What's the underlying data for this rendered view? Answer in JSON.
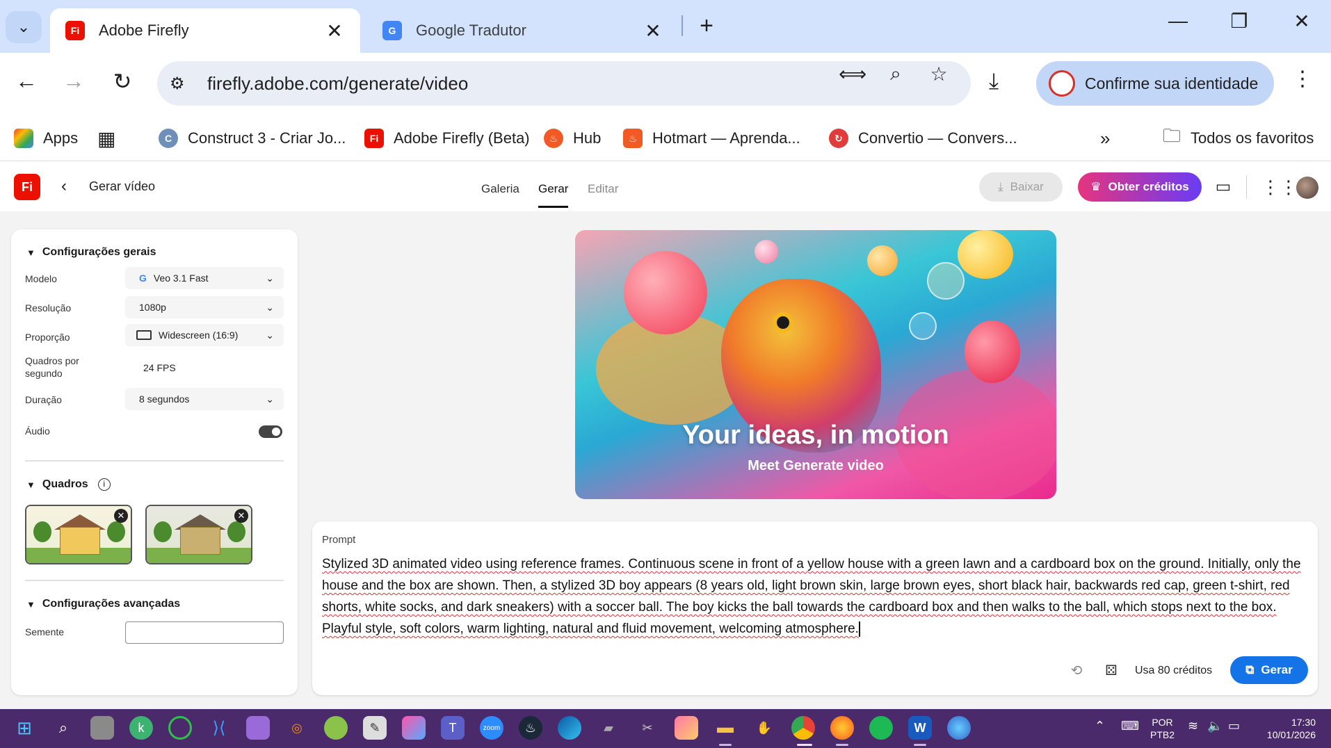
{
  "browser": {
    "tabs": [
      {
        "title": "Adobe Firefly",
        "active": true
      },
      {
        "title": "Google Tradutor",
        "active": false
      }
    ],
    "address": "firefly.adobe.com/generate/video",
    "profile_label": "Confirme sua identidade",
    "bookmarks": [
      "Apps",
      "Construct 3 - Criar Jo...",
      "Adobe Firefly (Beta)",
      "Hub",
      "Hotmart — Aprenda...",
      "Convertio — Convers...",
      "Todos os favoritos"
    ]
  },
  "app": {
    "page_title": "Gerar vídeo",
    "nav_tabs": [
      "Galeria",
      "Gerar",
      "Editar"
    ],
    "active_tab": "Gerar",
    "download_label": "Baixar",
    "credits_button": "Obter créditos",
    "colors": {
      "accent": "#1473e6",
      "logo": "#eb1000",
      "credits_gradient_start": "#e6347e",
      "credits_gradient_end": "#6a3cf5"
    }
  },
  "settings": {
    "general_title": "Configurações gerais",
    "model_label": "Modelo",
    "model_value": "Veo 3.1 Fast",
    "resolution_label": "Resolução",
    "resolution_value": "1080p",
    "aspect_label": "Proporção",
    "aspect_value": "Widescreen (16:9)",
    "fps_label_1": "Quadros por",
    "fps_label_2": "segundo",
    "fps_value": "24 FPS",
    "duration_label": "Duração",
    "duration_value": "8 segundos",
    "audio_label": "Áudio",
    "audio_on": true,
    "frames_title": "Quadros",
    "advanced_title": "Configurações avançadas",
    "seed_label": "Semente",
    "seed_value": ""
  },
  "hero": {
    "title": "Your ideas, in motion",
    "subtitle": "Meet Generate video"
  },
  "prompt": {
    "label": "Prompt",
    "text": "Stylized 3D animated video using reference frames. Continuous scene in front of a yellow house with a green lawn and a cardboard box on the ground. Initially, only the house and the box are shown. Then, a stylized 3D boy appears (8 years old, light brown skin, large brown eyes, short black hair, backwards red cap, green t-shirt, red shorts, white socks, and dark sneakers) with a soccer ball. The boy kicks the ball towards the cardboard box and then walks to the ball, which stops next to the box. Playful style, soft colors, warm lighting, natural and fluid movement, welcoming atmosphere.",
    "credits": "Usa 80 créditos",
    "generate_label": "Gerar"
  },
  "taskbar": {
    "lang_1": "POR",
    "lang_2": "PTB2",
    "time": "17:30",
    "date": "10/01/2026"
  }
}
